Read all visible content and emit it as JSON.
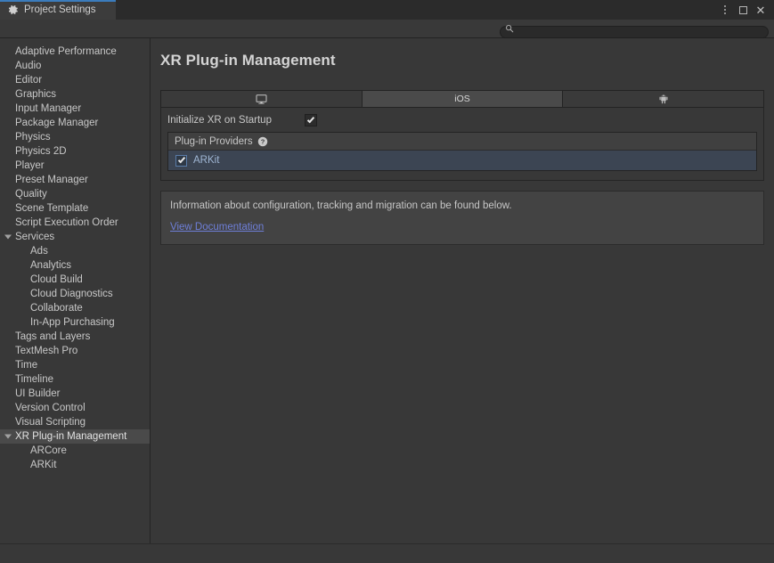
{
  "window": {
    "tab_label": "Project Settings",
    "tab_icon": "gear-icon",
    "controls": {
      "menu": "kebab-menu-icon",
      "maximize": "maximize-icon",
      "close": "close-icon"
    }
  },
  "search": {
    "value": "",
    "placeholder": "",
    "icon": "search-icon"
  },
  "sidebar": {
    "items": [
      {
        "label": "Adaptive Performance",
        "level": 0,
        "expandable": false,
        "selected": false
      },
      {
        "label": "Audio",
        "level": 0,
        "expandable": false,
        "selected": false
      },
      {
        "label": "Editor",
        "level": 0,
        "expandable": false,
        "selected": false
      },
      {
        "label": "Graphics",
        "level": 0,
        "expandable": false,
        "selected": false
      },
      {
        "label": "Input Manager",
        "level": 0,
        "expandable": false,
        "selected": false
      },
      {
        "label": "Package Manager",
        "level": 0,
        "expandable": false,
        "selected": false
      },
      {
        "label": "Physics",
        "level": 0,
        "expandable": false,
        "selected": false
      },
      {
        "label": "Physics 2D",
        "level": 0,
        "expandable": false,
        "selected": false
      },
      {
        "label": "Player",
        "level": 0,
        "expandable": false,
        "selected": false
      },
      {
        "label": "Preset Manager",
        "level": 0,
        "expandable": false,
        "selected": false
      },
      {
        "label": "Quality",
        "level": 0,
        "expandable": false,
        "selected": false
      },
      {
        "label": "Scene Template",
        "level": 0,
        "expandable": false,
        "selected": false
      },
      {
        "label": "Script Execution Order",
        "level": 0,
        "expandable": false,
        "selected": false
      },
      {
        "label": "Services",
        "level": 0,
        "expandable": true,
        "selected": false
      },
      {
        "label": "Ads",
        "level": 1,
        "expandable": false,
        "selected": false
      },
      {
        "label": "Analytics",
        "level": 1,
        "expandable": false,
        "selected": false
      },
      {
        "label": "Cloud Build",
        "level": 1,
        "expandable": false,
        "selected": false
      },
      {
        "label": "Cloud Diagnostics",
        "level": 1,
        "expandable": false,
        "selected": false
      },
      {
        "label": "Collaborate",
        "level": 1,
        "expandable": false,
        "selected": false
      },
      {
        "label": "In-App Purchasing",
        "level": 1,
        "expandable": false,
        "selected": false
      },
      {
        "label": "Tags and Layers",
        "level": 0,
        "expandable": false,
        "selected": false
      },
      {
        "label": "TextMesh Pro",
        "level": 0,
        "expandable": false,
        "selected": false
      },
      {
        "label": "Time",
        "level": 0,
        "expandable": false,
        "selected": false
      },
      {
        "label": "Timeline",
        "level": 0,
        "expandable": false,
        "selected": false
      },
      {
        "label": "UI Builder",
        "level": 0,
        "expandable": false,
        "selected": false
      },
      {
        "label": "Version Control",
        "level": 0,
        "expandable": false,
        "selected": false
      },
      {
        "label": "Visual Scripting",
        "level": 0,
        "expandable": false,
        "selected": false
      },
      {
        "label": "XR Plug-in Management",
        "level": 0,
        "expandable": true,
        "selected": true
      },
      {
        "label": "ARCore",
        "level": 1,
        "expandable": false,
        "selected": false
      },
      {
        "label": "ARKit",
        "level": 1,
        "expandable": false,
        "selected": false
      }
    ]
  },
  "main": {
    "title": "XR Plug-in Management",
    "platform_tabs": [
      {
        "label": "",
        "icon": "desktop-monitor-icon",
        "active": false
      },
      {
        "label": "iOS",
        "icon": "",
        "active": true
      },
      {
        "label": "",
        "icon": "android-robot-icon",
        "active": false
      }
    ],
    "initialize_xr": {
      "label": "Initialize XR on Startup",
      "checked": true
    },
    "providers": {
      "header": "Plug-in Providers",
      "help_icon": "help-icon",
      "items": [
        {
          "label": "ARKit",
          "checked": true,
          "selected": true
        }
      ]
    },
    "info": {
      "text": "Information about configuration, tracking and migration can be found below.",
      "link": "View Documentation"
    }
  },
  "colors": {
    "accent_tab": "#3b7cbc",
    "link": "#6e7fd8",
    "selection": "#4a4a4a",
    "provider_selection": "#3c4553",
    "window_bg": "#383838"
  }
}
